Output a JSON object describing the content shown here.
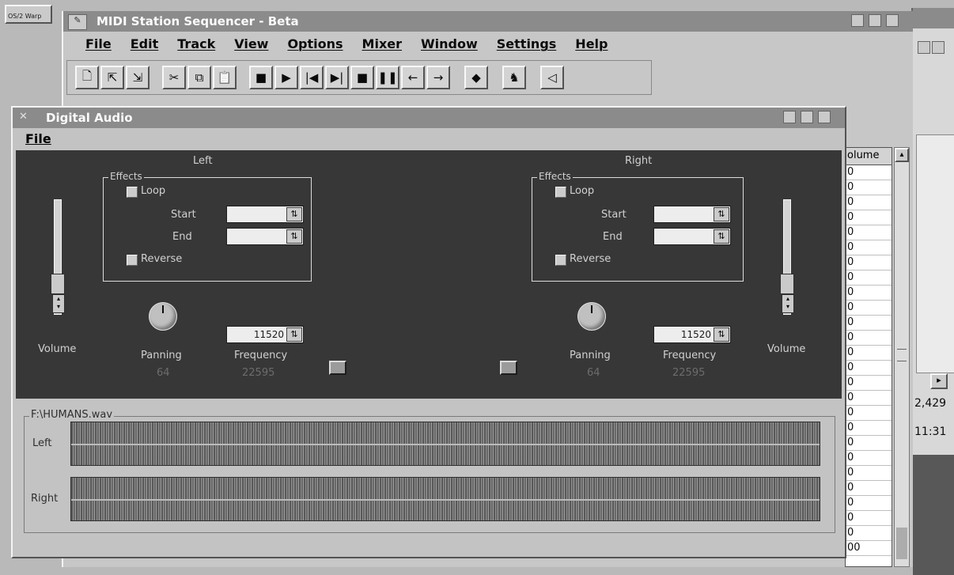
{
  "desktop": {
    "os_badge": "OS/2 Warp"
  },
  "main_window": {
    "title": "MIDI Station Sequencer - Beta",
    "menu": [
      "File",
      "Edit",
      "Track",
      "View",
      "Options",
      "Mixer",
      "Window",
      "Settings",
      "Help"
    ],
    "toolbar": [
      "new-file",
      "open-file",
      "save-file",
      "cut",
      "copy",
      "paste",
      "record",
      "play",
      "rewind",
      "fast-forward",
      "stop",
      "pause",
      "step-back",
      "step-forward",
      "metronome",
      "keyboard",
      "speaker"
    ]
  },
  "digital_audio": {
    "title": "Digital Audio",
    "menu_file": "File",
    "left": {
      "heading": "Left",
      "effects_title": "Effects",
      "loop_label": "Loop",
      "start_label": "Start",
      "end_label": "End",
      "reverse_label": "Reverse",
      "volume_label": "Volume",
      "panning_label": "Panning",
      "panning_value": "64",
      "frequency_label": "Frequency",
      "frequency_field": "11520",
      "frequency_value": "22595",
      "volume_level": 0.25
    },
    "right": {
      "heading": "Right",
      "effects_title": "Effects",
      "loop_label": "Loop",
      "start_label": "Start",
      "end_label": "End",
      "reverse_label": "Reverse",
      "volume_label": "Volume",
      "panning_label": "Panning",
      "panning_value": "64",
      "frequency_label": "Frequency",
      "frequency_field": "11520",
      "frequency_value": "22595",
      "volume_level": 0.25
    },
    "wave_file": "F:\\HUMANS.wav",
    "channel_left": "Left",
    "channel_right": "Right"
  },
  "track_list": {
    "header": "olume",
    "values": [
      "0",
      "0",
      "0",
      "0",
      "0",
      "0",
      "0",
      "0",
      "0",
      "0",
      "0",
      "0",
      "0",
      "0",
      "0",
      "0",
      "0",
      "0",
      "0",
      "0",
      "0",
      "0",
      "0",
      "0",
      "0",
      "00"
    ]
  },
  "right_window": {
    "value1": "2,429",
    "value2": "11:31"
  }
}
